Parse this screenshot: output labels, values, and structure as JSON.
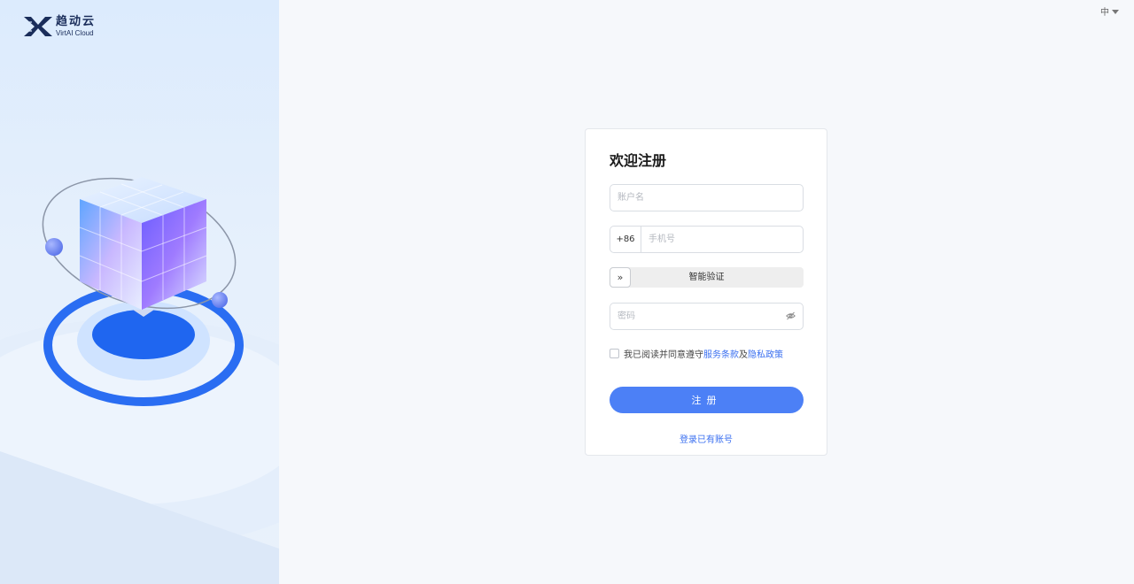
{
  "brand": {
    "name_cn": "趋动云",
    "name_en": "VirtAI Cloud"
  },
  "language": {
    "current": "中"
  },
  "register": {
    "title": "欢迎注册",
    "account_placeholder": "账户名",
    "phone_code": "+86",
    "phone_placeholder": "手机号",
    "slider_text": "智能验证",
    "slider_handle": "»",
    "password_placeholder": "密码",
    "agree_prefix": "我已阅读并同意遵守",
    "terms_link": "服务条款",
    "agree_and": "及",
    "privacy_link": "隐私政策",
    "submit_label": "注册",
    "login_link": "登录已有账号"
  },
  "icons": {
    "logo": "x-logo-icon",
    "eye": "eye-off-icon",
    "caret": "caret-down-icon"
  },
  "colors": {
    "accent": "#4c80f6",
    "link": "#3a6ff0"
  }
}
